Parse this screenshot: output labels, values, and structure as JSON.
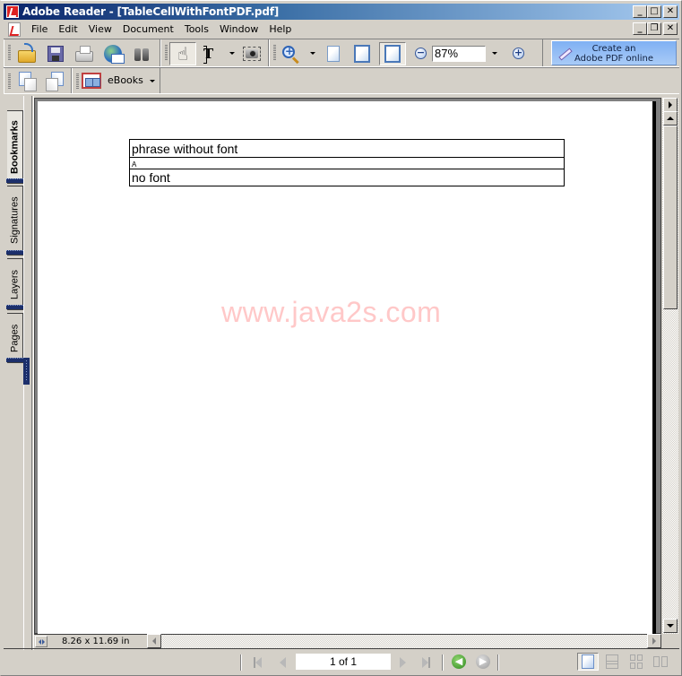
{
  "window": {
    "title": "Adobe Reader - [TableCellWithFontPDF.pdf]",
    "controls": {
      "minimize": "_",
      "maximize": "□",
      "close": "✕"
    },
    "doc_controls": {
      "minimize": "_",
      "restore": "❐",
      "close": "✕"
    }
  },
  "menu": {
    "items": [
      "File",
      "Edit",
      "View",
      "Document",
      "Tools",
      "Window",
      "Help"
    ]
  },
  "toolbar": {
    "file_tools": [
      "open-icon",
      "save-icon",
      "print-icon",
      "email-icon",
      "search-icon"
    ],
    "basic_tools": [
      "hand-tool-icon",
      "select-text-icon",
      "snapshot-icon"
    ],
    "hand_glyph": "☝",
    "select_glyph": "T",
    "zoom_level": "87%",
    "zoom_out_glyph": "−",
    "zoom_in_glyph": "+",
    "hand_tool_active": true,
    "fit_width_active": true,
    "create_pdf": {
      "line1": "Create an",
      "line2": "Adobe PDF online"
    },
    "ebooks_label": "eBooks"
  },
  "nav_panel": {
    "tabs": [
      {
        "label": "Bookmarks",
        "active": true
      },
      {
        "label": "Signatures",
        "active": false
      },
      {
        "label": "Layers",
        "active": false
      },
      {
        "label": "Pages",
        "active": false
      }
    ]
  },
  "document": {
    "table_rows": [
      "phrase without font",
      "A",
      "no font"
    ],
    "watermark": "www.java2s.com",
    "page_size": "8.26 x 11.69 in"
  },
  "statusbar": {
    "page_indicator": "1 of 1",
    "back_glyph": "◀",
    "forward_glyph": "▶",
    "active_layout": "single-page"
  },
  "colors": {
    "titlebar_start": "#0a246a",
    "titlebar_end": "#a6caf0",
    "chrome": "#d4d0c8",
    "watermark": "#ffc8c8",
    "create_pdf_button": "#8fbaf5",
    "nav_tab_foot": "#1c2f6b"
  }
}
